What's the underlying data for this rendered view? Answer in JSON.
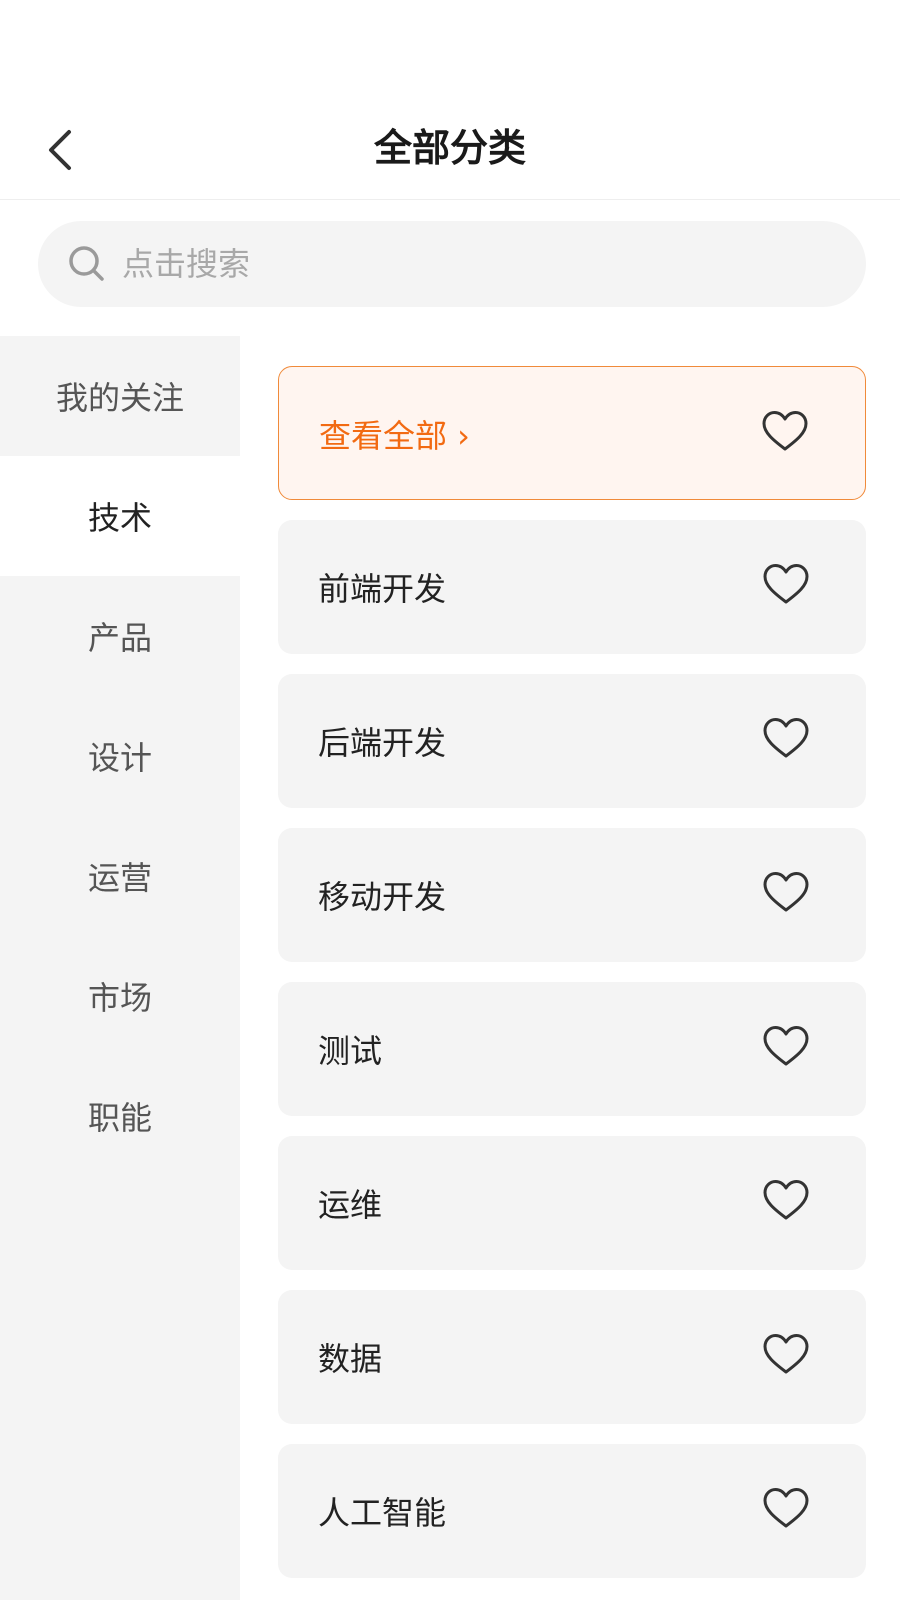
{
  "header": {
    "title": "全部分类",
    "back_icon": "chevron-left-icon"
  },
  "search": {
    "placeholder": "点击搜索",
    "value": "",
    "icon": "search-icon"
  },
  "sidebar": {
    "items": [
      {
        "label": "我的关注",
        "active": false
      },
      {
        "label": "技术",
        "active": true
      },
      {
        "label": "产品",
        "active": false
      },
      {
        "label": "设计",
        "active": false
      },
      {
        "label": "运营",
        "active": false
      },
      {
        "label": "市场",
        "active": false
      },
      {
        "label": "职能",
        "active": false
      }
    ]
  },
  "categories": {
    "view_all": {
      "label": "查看全部 ›",
      "icon": "heart-outline-icon"
    },
    "items": [
      {
        "label": "前端开发",
        "icon": "heart-outline-icon"
      },
      {
        "label": "后端开发",
        "icon": "heart-outline-icon"
      },
      {
        "label": "移动开发",
        "icon": "heart-outline-icon"
      },
      {
        "label": "测试",
        "icon": "heart-outline-icon"
      },
      {
        "label": "运维",
        "icon": "heart-outline-icon"
      },
      {
        "label": "数据",
        "icon": "heart-outline-icon"
      },
      {
        "label": "人工智能",
        "icon": "heart-outline-icon"
      }
    ]
  },
  "colors": {
    "accent": "#f26a12",
    "accent_border": "#f08a3a",
    "highlight_bg": "#fff5f0",
    "card_bg": "#f4f4f4",
    "sidebar_bg": "#f4f4f4"
  }
}
